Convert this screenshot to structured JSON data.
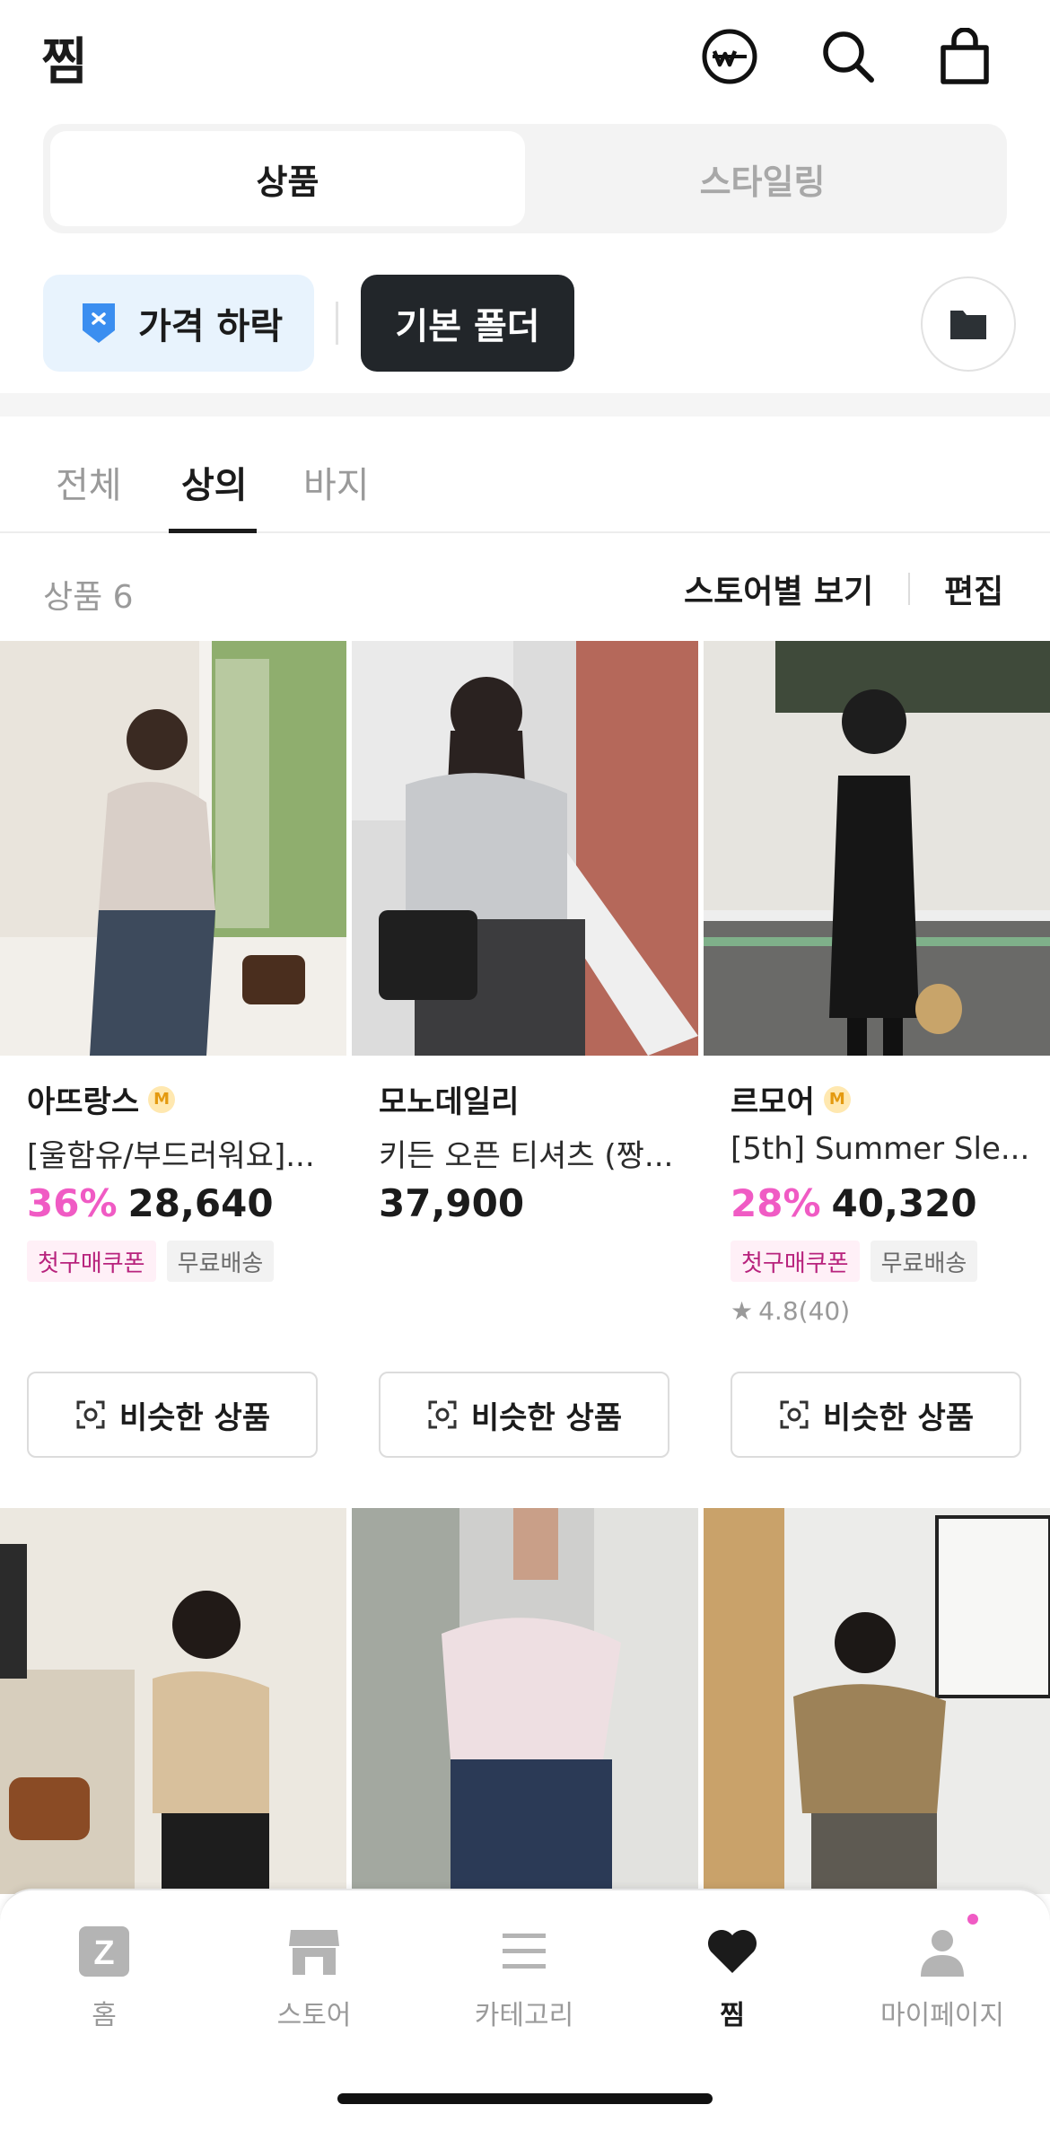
{
  "header": {
    "title": "찜"
  },
  "segmented": {
    "tab_products": "상품",
    "tab_styling": "스타일링"
  },
  "chips": {
    "price_drop": "가격 하락",
    "default_folder": "기본 폴더"
  },
  "category_tabs": {
    "all": "전체",
    "tops": "상의",
    "pants": "바지"
  },
  "list_header": {
    "count": "상품 6",
    "store_view": "스토어별 보기",
    "edit": "편집"
  },
  "products": [
    {
      "store": "아뜨랑스",
      "title": "[울함유/부드러워요]...",
      "discount": "36%",
      "price": "28,640",
      "coupon": "첫구매쿠폰",
      "free_ship": "무료배송",
      "rating": ""
    },
    {
      "store": "모노데일리",
      "title": "키든 오픈 티셔츠 (짱...",
      "discount": "",
      "price": "37,900",
      "coupon": "",
      "free_ship": "",
      "rating": ""
    },
    {
      "store": "르모어",
      "title": "[5th] Summer Sle...",
      "discount": "28%",
      "price": "40,320",
      "coupon": "첫구매쿠폰",
      "free_ship": "무료배송",
      "rating": "4.8(40)"
    }
  ],
  "similar_label": "비슷한 상품",
  "m_badge": "M",
  "nav": {
    "home": "홈",
    "store": "스토어",
    "category": "카테고리",
    "zzim": "찜",
    "mypage": "마이페이지"
  },
  "home_glyph": "Z",
  "colors": {
    "accent_pink": "#f05bc4",
    "chip_dark": "#22262a",
    "chip_light_blue": "#e8f3fd",
    "text": "#1b1b1b"
  }
}
